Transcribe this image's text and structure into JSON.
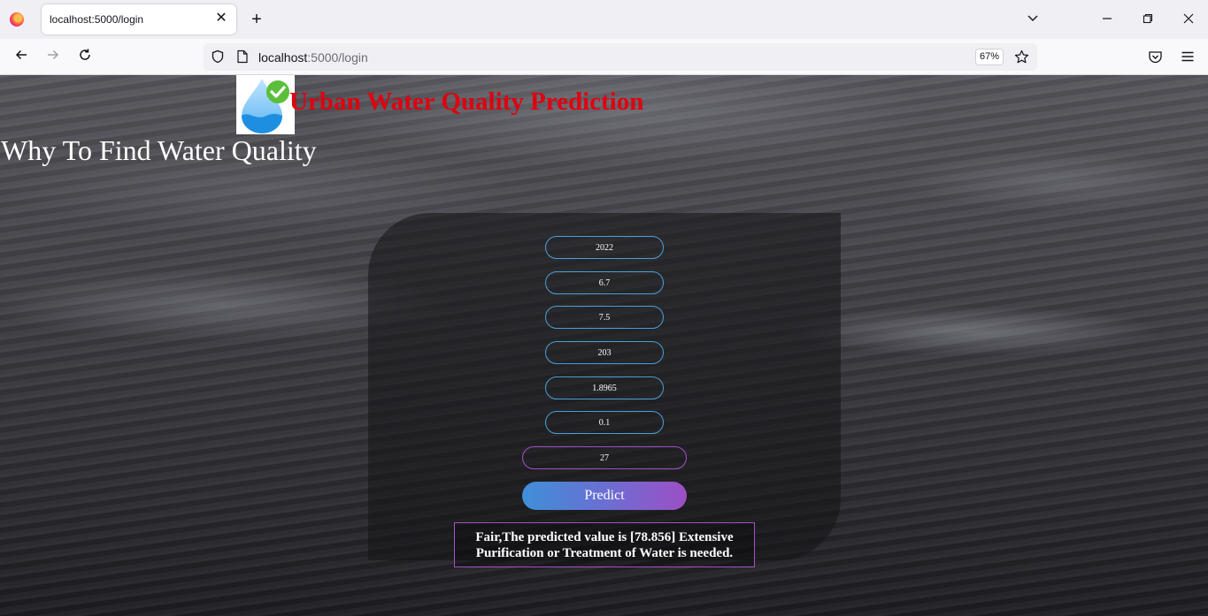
{
  "browser": {
    "tab_title": "localhost:5000/login",
    "url_host": "localhost",
    "url_path": ":5000/login",
    "zoom": "67%"
  },
  "page": {
    "title": "Urban Water Quality Prediction",
    "subtitle": "Why To Find Water Quality",
    "inputs": [
      {
        "name": "year",
        "value": "2022"
      },
      {
        "name": "field-2",
        "value": "6.7"
      },
      {
        "name": "field-3",
        "value": "7.5"
      },
      {
        "name": "field-4",
        "value": "203"
      },
      {
        "name": "field-5",
        "value": "1.8965"
      },
      {
        "name": "field-6",
        "value": "0.1"
      },
      {
        "name": "field-7",
        "value": "27"
      }
    ],
    "predict_label": "Predict",
    "result_text": "Fair,The predicted value is [78.856] Extensive Purification or Treatment of Water is needed."
  },
  "colors": {
    "title_red": "#e0000e",
    "input_border_blue": "#4a9fd6",
    "accent_purple": "#a64fc6"
  }
}
